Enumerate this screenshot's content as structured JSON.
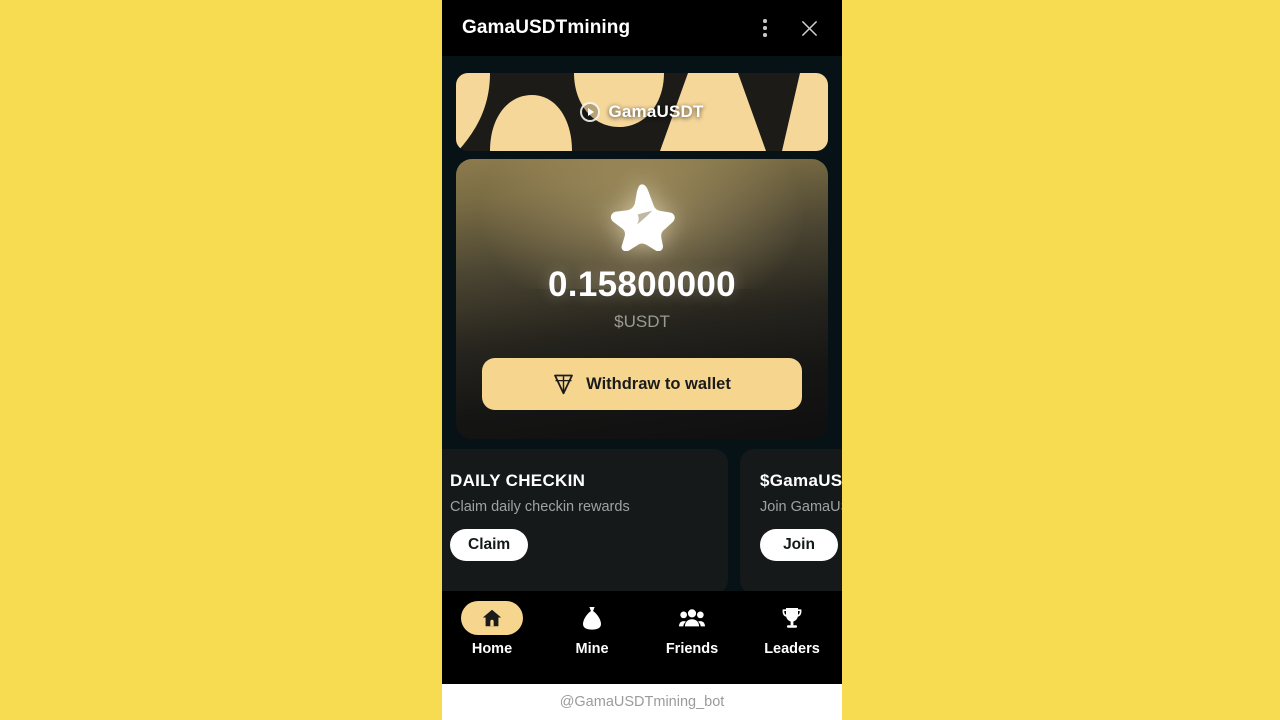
{
  "window": {
    "title": "GamaUSDTmining",
    "menu_icon": "more-vertical-icon",
    "close_icon": "close-icon"
  },
  "banner": {
    "text": "GamaUSDT",
    "play_icon": "play-circle-icon"
  },
  "balance": {
    "icon": "star-icon",
    "amount": "0.15800000",
    "ticker": "$USDT",
    "withdraw_label": "Withdraw to wallet",
    "withdraw_icon": "ton-diamond-icon"
  },
  "tasks": [
    {
      "title": "DAILY CHECKIN",
      "description": "Claim daily checkin rewards",
      "action": "Claim"
    },
    {
      "title": "$GamaUSDT",
      "description": "Join GamaUSDT channel",
      "action": "Join"
    }
  ],
  "nav": [
    {
      "label": "Home",
      "icon": "home-icon",
      "active": true
    },
    {
      "label": "Mine",
      "icon": "money-bag-icon",
      "active": false
    },
    {
      "label": "Friends",
      "icon": "people-icon",
      "active": false
    },
    {
      "label": "Leaders",
      "icon": "trophy-icon",
      "active": false
    }
  ],
  "footer": {
    "bot_handle": "@GamaUSDTmining_bot"
  },
  "colors": {
    "page_background": "#f7dc52",
    "app_background": "#061216",
    "header_background": "#000000",
    "accent": "#f6d68f",
    "card_background": "#16191a"
  }
}
